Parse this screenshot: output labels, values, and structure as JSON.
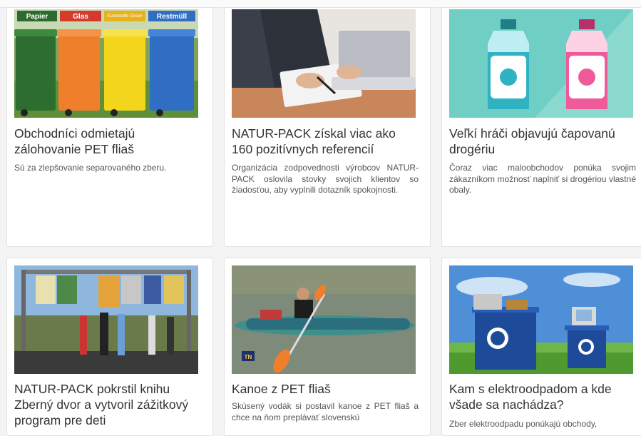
{
  "cards": [
    {
      "title": "Obchodníci odmietajú zálohovanie PET fliaš",
      "description": "Sú za zlepšovanie separovaného zberu.",
      "image_labels": [
        "Papier",
        "Glas",
        "Kunststoffe Dosen",
        "Restmüll"
      ]
    },
    {
      "title": "NATUR-PACK získal viac ako 160 pozitívnych referencií",
      "description": "Organizácia zodpovednosti výrobcov NATUR-PACK oslovila stovky svojich klientov so žiadosťou, aby vyplnili dotazník spokojnosti."
    },
    {
      "title": "Veľkí hráči objavujú čapovanú drogériu",
      "description": "Čoraz viac maloobchodov ponúka svojim zákazníkom možnosť naplniť si drogériou vlastné obaly."
    },
    {
      "title": "NATUR-PACK pokrstil knihu Zberný dvor a vytvoril zážitkový program pre deti",
      "description": ""
    },
    {
      "title": "Kanoe z PET fliaš",
      "description": "Skúsený vodák si postavil kanoe z PET fliaš a chce na ňom preplávať slovenskú",
      "image_labels": [
        "TN"
      ]
    },
    {
      "title": "Kam s elektroodpadom a kde všade sa nachádza?",
      "description": "Zber elektroodpadu ponúkajú obchody,"
    }
  ],
  "colors": {
    "bin_green": "#2e7d32",
    "bin_orange": "#f07f2b",
    "bin_yellow": "#f3d51c",
    "bin_blue": "#2f6ec2",
    "teal_bg": "#6fcfc4",
    "sky": "#4f8fd8"
  }
}
